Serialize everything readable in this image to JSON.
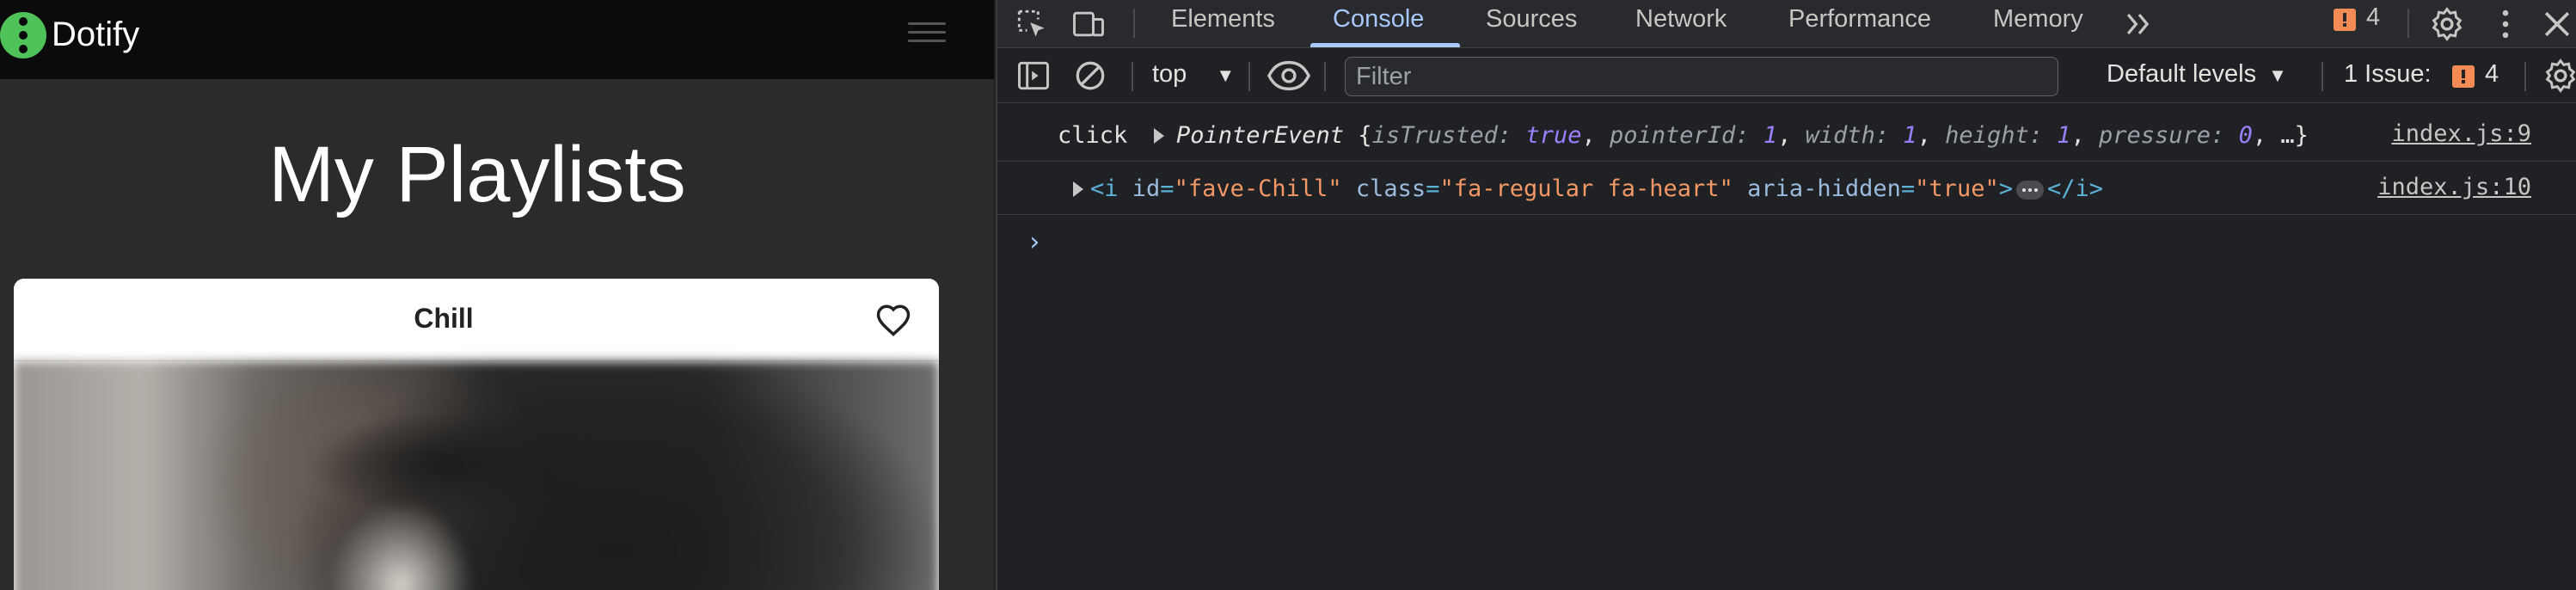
{
  "app": {
    "brand": "Dotify",
    "page_title": "My Playlists",
    "card": {
      "title": "Chill"
    }
  },
  "devtools": {
    "tabs": [
      {
        "label": "Elements"
      },
      {
        "label": "Console"
      },
      {
        "label": "Sources"
      },
      {
        "label": "Network"
      },
      {
        "label": "Performance"
      },
      {
        "label": "Memory"
      }
    ],
    "active_tab": "Console",
    "issue_count": "4",
    "toolbar": {
      "context": "top",
      "filter_placeholder": "Filter",
      "levels": "Default levels",
      "issues_label": "1 Issue:",
      "issues_count": "4"
    },
    "console": {
      "row1": {
        "label": "click",
        "type": "PointerEvent",
        "open_brace": "{",
        "k1": "isTrusted",
        "v1": "true",
        "k2": "pointerId",
        "v2": "1",
        "k3": "width",
        "v3": "1",
        "k4": "height",
        "v4": "1",
        "k5": "pressure",
        "v5": "0",
        "tail": "…}",
        "source": "index.js:9"
      },
      "row2": {
        "tag_open": "<i",
        "a1": "id",
        "v1": "\"fave-Chill\"",
        "a2": "class",
        "v2": "\"fa-regular fa-heart\"",
        "a3": "aria-hidden",
        "v3": "\"true\"",
        "close_bracket": ">",
        "tag_close": "</i>",
        "source": "index.js:10"
      },
      "prompt": "›"
    }
  },
  "colors": {
    "brand_green": "#4fc25a",
    "devtools_accent": "#a8c7fa",
    "issue_orange": "#f28b54"
  }
}
